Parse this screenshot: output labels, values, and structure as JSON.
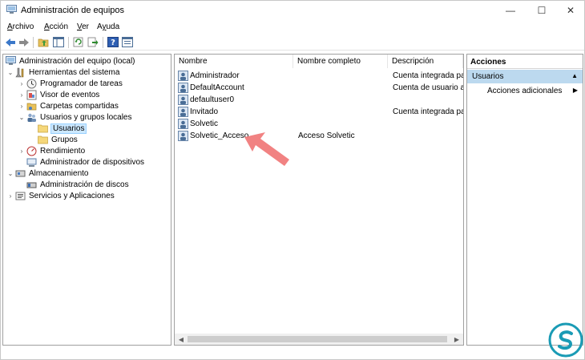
{
  "window": {
    "title": "Administración de equipos",
    "controls": {
      "minimize": "—",
      "maximize": "☐",
      "close": "✕"
    }
  },
  "menu": [
    {
      "label": "Archivo",
      "hotkey_index": 0
    },
    {
      "label": "Acción",
      "hotkey_index": 0
    },
    {
      "label": "Ver",
      "hotkey_index": 0
    },
    {
      "label": "Ayuda",
      "hotkey_index": 1
    }
  ],
  "toolbar": {
    "icons": [
      "back-icon",
      "forward-icon",
      "up-folder-icon",
      "show-hide-tree-icon",
      "refresh-icon",
      "export-list-icon",
      "help-icon",
      "properties-icon"
    ]
  },
  "tree": {
    "root": "Administración del equipo (local)",
    "system_tools": "Herramientas del sistema",
    "task_scheduler": "Programador de tareas",
    "event_viewer": "Visor de eventos",
    "shared_folders": "Carpetas compartidas",
    "local_users_groups": "Usuarios y grupos locales",
    "users": "Usuarios",
    "groups": "Grupos",
    "performance": "Rendimiento",
    "device_manager": "Administrador de dispositivos",
    "storage": "Almacenamiento",
    "disk_management": "Administración de discos",
    "services_apps": "Servicios y Aplicaciones"
  },
  "list": {
    "columns": [
      "Nombre",
      "Nombre completo",
      "Descripción"
    ],
    "rows": [
      {
        "name": "Administrador",
        "full_name": "",
        "description": "Cuenta integrada para"
      },
      {
        "name": "DefaultAccount",
        "full_name": "",
        "description": "Cuenta de usuario ad"
      },
      {
        "name": "defaultuser0",
        "full_name": "",
        "description": ""
      },
      {
        "name": "Invitado",
        "full_name": "",
        "description": "Cuenta integrada para"
      },
      {
        "name": "Solvetic",
        "full_name": "",
        "description": ""
      },
      {
        "name": "Solvetic_Acceso",
        "full_name": "Acceso Solvetic",
        "description": ""
      }
    ]
  },
  "actions": {
    "header": "Acciones",
    "section": "Usuarios",
    "more": "Acciones adicionales"
  },
  "colors": {
    "selection": "#cce8ff",
    "actions_section": "#bcd9ef",
    "annotation_arrow": "#f07b7b",
    "watermark": "#1a9bb5"
  }
}
